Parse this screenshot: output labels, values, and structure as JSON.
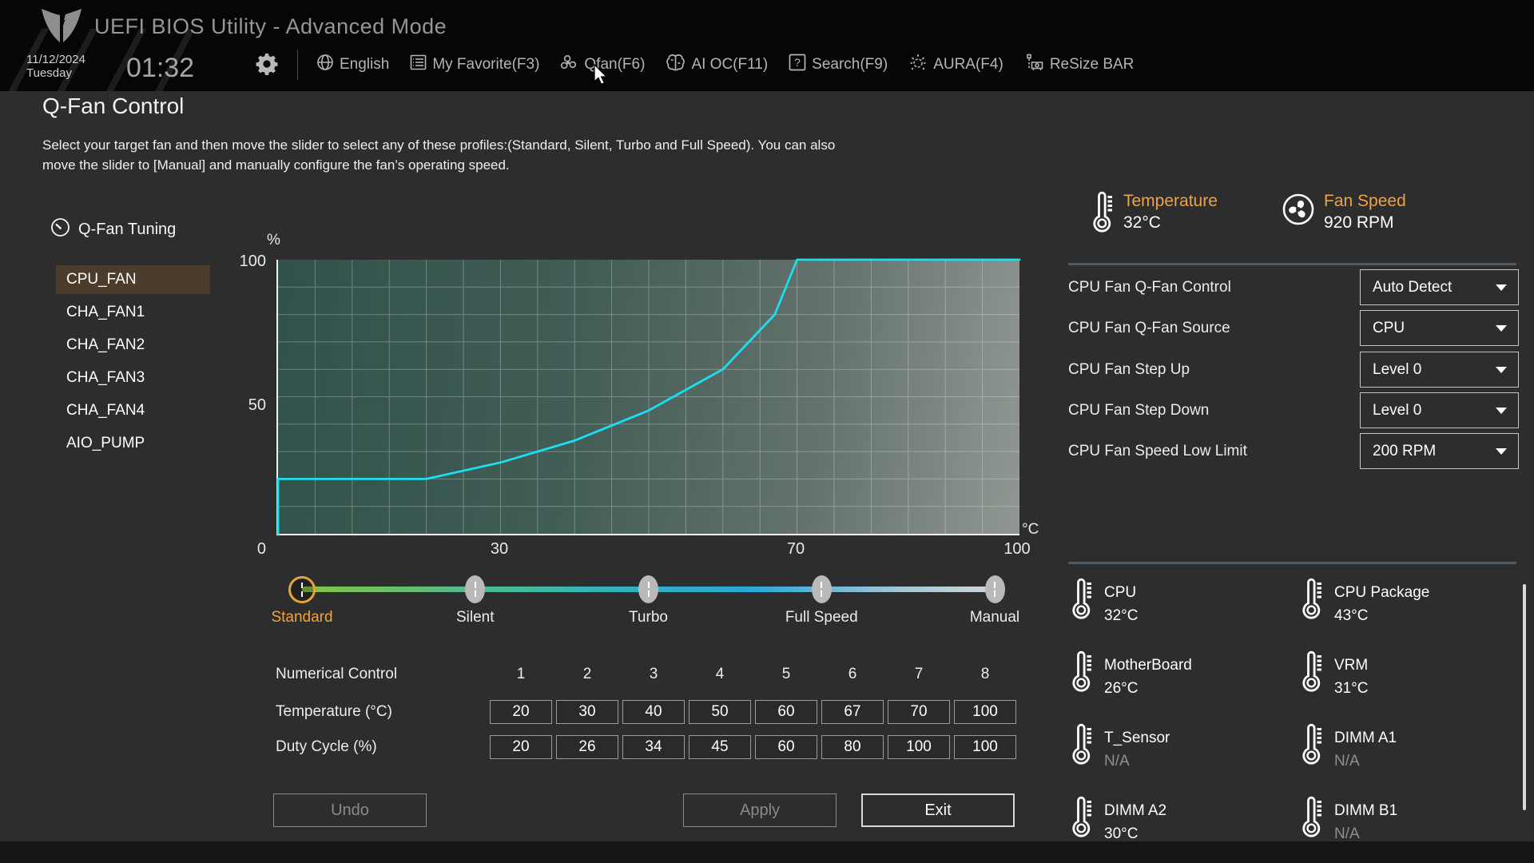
{
  "header": {
    "title": "UEFI BIOS Utility - Advanced Mode",
    "date": "11/12/2024",
    "weekday": "Tuesday",
    "time": "01:32",
    "menu": [
      {
        "label": "English",
        "icon": "globe-icon"
      },
      {
        "label": "My Favorite(F3)",
        "icon": "list-icon"
      },
      {
        "label": "Qfan(F6)",
        "icon": "fan-icon"
      },
      {
        "label": "AI OC(F11)",
        "icon": "brain-icon"
      },
      {
        "label": "Search(F9)",
        "icon": "question-icon"
      },
      {
        "label": "AURA(F4)",
        "icon": "aura-icon"
      },
      {
        "label": "ReSize BAR",
        "icon": "gpu-icon"
      }
    ]
  },
  "page": {
    "title": "Q-Fan Control",
    "description_line1": "Select your target fan and then move the slider to select any of these profiles:(Standard, Silent, Turbo and Full Speed). You can also",
    "description_line2": "move the slider to [Manual] and manually configure the fan’s operating speed."
  },
  "sidebar": {
    "tuning_label": "Q-Fan Tuning",
    "fans": [
      {
        "label": "CPU_FAN",
        "selected": true
      },
      {
        "label": "CHA_FAN1",
        "selected": false
      },
      {
        "label": "CHA_FAN2",
        "selected": false
      },
      {
        "label": "CHA_FAN3",
        "selected": false
      },
      {
        "label": "CHA_FAN4",
        "selected": false
      },
      {
        "label": "AIO_PUMP",
        "selected": false
      }
    ]
  },
  "chart_data": {
    "type": "line",
    "title": "CPU_FAN fan curve",
    "xlabel": "Temperature (°C)",
    "ylabel": "Duty Cycle (%)",
    "xlim": [
      0,
      100
    ],
    "ylim": [
      0,
      100
    ],
    "grid": {
      "x_step": 5,
      "y_step": 10
    },
    "line_color": "#1adfef",
    "points": [
      [
        0,
        0
      ],
      [
        0,
        20
      ],
      [
        20,
        20
      ],
      [
        30,
        26
      ],
      [
        40,
        34
      ],
      [
        50,
        45
      ],
      [
        60,
        60
      ],
      [
        67,
        80
      ],
      [
        70,
        100
      ],
      [
        100,
        100
      ]
    ],
    "labels": {
      "unit_y": "%",
      "y100": "100",
      "y50": "50",
      "origin": "0",
      "x30": "30",
      "x70": "70",
      "x100": "100",
      "unit_x": "°C"
    }
  },
  "slider": {
    "selected": "Standard",
    "profiles": [
      {
        "label": "Standard"
      },
      {
        "label": "Silent"
      },
      {
        "label": "Turbo"
      },
      {
        "label": "Full Speed"
      },
      {
        "label": "Manual"
      }
    ]
  },
  "numerical": {
    "row_label": "Numerical Control",
    "col_headers": [
      "1",
      "2",
      "3",
      "4",
      "5",
      "6",
      "7",
      "8"
    ],
    "temp_label": "Temperature (°C)",
    "temp_values": [
      "20",
      "30",
      "40",
      "50",
      "60",
      "67",
      "70",
      "100"
    ],
    "duty_label": "Duty Cycle (%)",
    "duty_values": [
      "20",
      "26",
      "34",
      "45",
      "60",
      "80",
      "100",
      "100"
    ]
  },
  "buttons": {
    "undo": "Undo",
    "apply": "Apply",
    "exit": "Exit"
  },
  "status": {
    "temperature_label": "Temperature",
    "temperature_value": "32°C",
    "fan_speed_label": "Fan Speed",
    "fan_speed_value": "920 RPM"
  },
  "settings": [
    {
      "label": "CPU Fan Q-Fan Control",
      "value": "Auto Detect"
    },
    {
      "label": "CPU Fan Q-Fan Source",
      "value": "CPU"
    },
    {
      "label": "CPU Fan Step Up",
      "value": "Level 0"
    },
    {
      "label": "CPU Fan Step Down",
      "value": "Level 0"
    },
    {
      "label": "CPU Fan Speed Low Limit",
      "value": "200 RPM"
    }
  ],
  "sensors": [
    {
      "name": "CPU",
      "value": "32°C",
      "na": false
    },
    {
      "name": "CPU Package",
      "value": "43°C",
      "na": false
    },
    {
      "name": "MotherBoard",
      "value": "26°C",
      "na": false
    },
    {
      "name": "VRM",
      "value": "31°C",
      "na": false
    },
    {
      "name": "T_Sensor",
      "value": "N/A",
      "na": true
    },
    {
      "name": "DIMM A1",
      "value": "N/A",
      "na": true
    },
    {
      "name": "DIMM A2",
      "value": "30°C",
      "na": false
    },
    {
      "name": "DIMM B1",
      "value": "N/A",
      "na": true
    }
  ],
  "colors": {
    "accent_orange": "#f0a343",
    "curve_cyan": "#1adfef",
    "selected_fan_bg": "#4b3c2b"
  }
}
